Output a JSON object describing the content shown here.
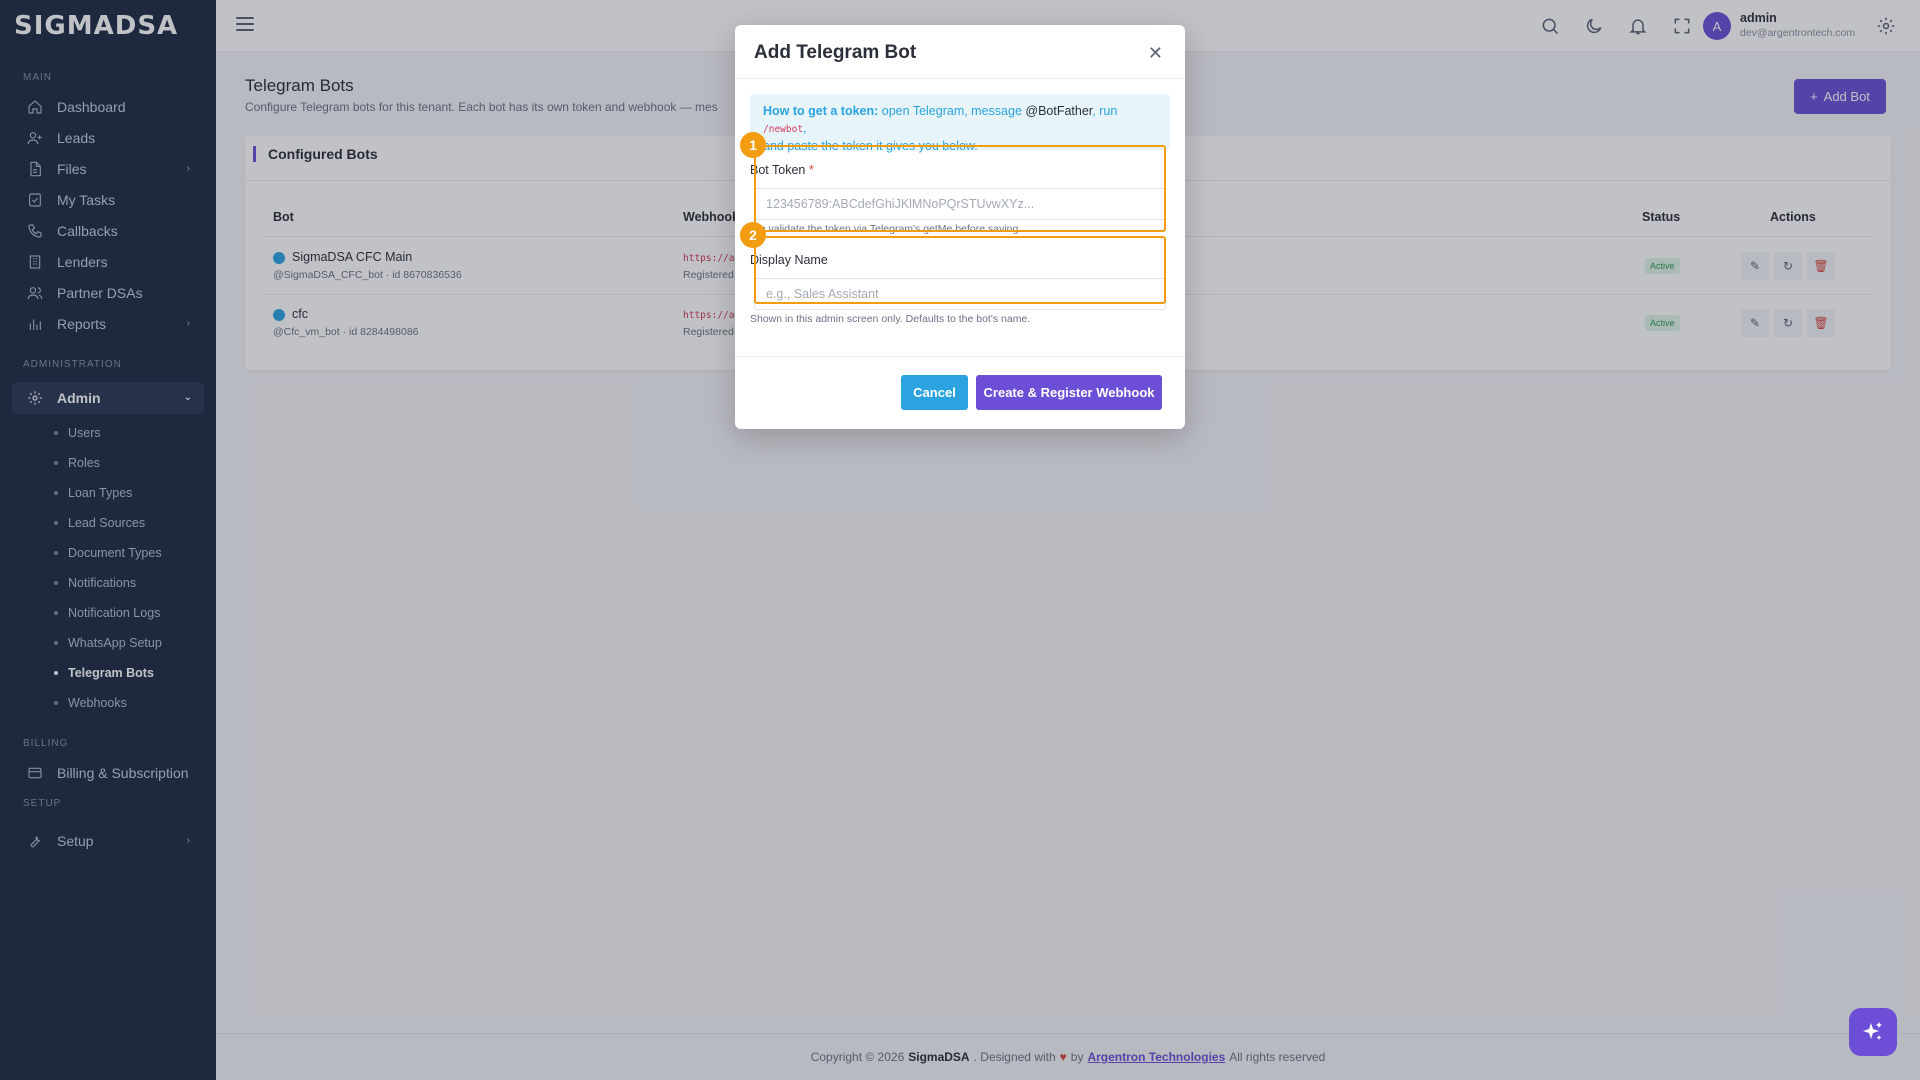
{
  "brand": "SIGMADSA",
  "sidebar": {
    "sections": [
      "MAIN",
      "ADMINISTRATION",
      "BILLING",
      "SETUP"
    ],
    "main_items": [
      {
        "label": "Dashboard",
        "icon": "home-icon"
      },
      {
        "label": "Leads",
        "icon": "user-plus-icon"
      },
      {
        "label": "Files",
        "icon": "file-icon"
      },
      {
        "label": "My Tasks",
        "icon": "task-icon"
      },
      {
        "label": "Callbacks",
        "icon": "phone-icon"
      },
      {
        "label": "Lenders",
        "icon": "building-icon"
      },
      {
        "label": "Partner DSAs",
        "icon": "users-icon"
      },
      {
        "label": "Reports",
        "icon": "bar-chart-icon"
      }
    ],
    "admin": {
      "label": "Admin",
      "icon": "gear-icon"
    },
    "admin_items": [
      "Users",
      "Roles",
      "Loan Types",
      "Lead Sources",
      "Document Types",
      "Notifications",
      "Notification Logs",
      "WhatsApp Setup",
      "Telegram Bots",
      "Webhooks"
    ],
    "billing_item": {
      "label": "Billing & Subscription",
      "icon": "card-icon"
    },
    "setup_item": {
      "label": "Setup",
      "icon": "wrench-icon"
    }
  },
  "topbar": {
    "user_initial": "A",
    "user_name": "admin",
    "user_email": "dev@argentrontech.com"
  },
  "page": {
    "title": "Telegram Bots",
    "subtitle": "Configure Telegram bots for this tenant. Each bot has its own token and webhook — mes",
    "add_button": "Add Bot"
  },
  "card": {
    "title": "Configured Bots",
    "columns": {
      "bot": "Bot",
      "webhook": "Webhook",
      "status": "Status",
      "actions": "Actions"
    },
    "rows": [
      {
        "name": "SigmaDSA CFC Main",
        "meta": "@SigmaDSA_CFC_bot · id 8670836536",
        "hook": "https://a",
        "hook_sub": "Registered",
        "status": "Active"
      },
      {
        "name": "cfc",
        "meta": "@Cfc_vm_bot · id 8284498086",
        "hook": "https://a",
        "hook_sub": "Registered",
        "status": "Active"
      }
    ]
  },
  "modal": {
    "title": "Add Telegram Bot",
    "hint_bold": "How to get a token:",
    "hint_1": "open Telegram, message",
    "hint_handle": "@BotFather",
    "hint_2": ", run",
    "hint_code": "/newbot",
    "hint_3": ",",
    "hint_4": "and paste the token it gives you below.",
    "token_label": "Bot Token",
    "token_required": "*",
    "token_placeholder": "123456789:ABCdefGhiJKlMNoPQrSTUvwXYz...",
    "token_help": "We validate the token via Telegram's getMe before saving.",
    "name_label": "Display Name",
    "name_placeholder": "e.g., Sales Assistant",
    "name_help": "Shown in this admin screen only. Defaults to the bot's name.",
    "cancel": "Cancel",
    "create": "Create & Register Webhook",
    "markers": [
      "1",
      "2"
    ]
  },
  "footer": {
    "prefix": "Copyright © 2026",
    "company": "SigmaDSA",
    "designed": ". Designed with",
    "by": "by",
    "link": "Argentron Technologies",
    "suffix": "All rights reserved"
  },
  "colors": {
    "accent": "#6c4fd6",
    "info": "#2aa3e0",
    "highlight": "#f39c12",
    "sidebar": "#1f2a44"
  }
}
